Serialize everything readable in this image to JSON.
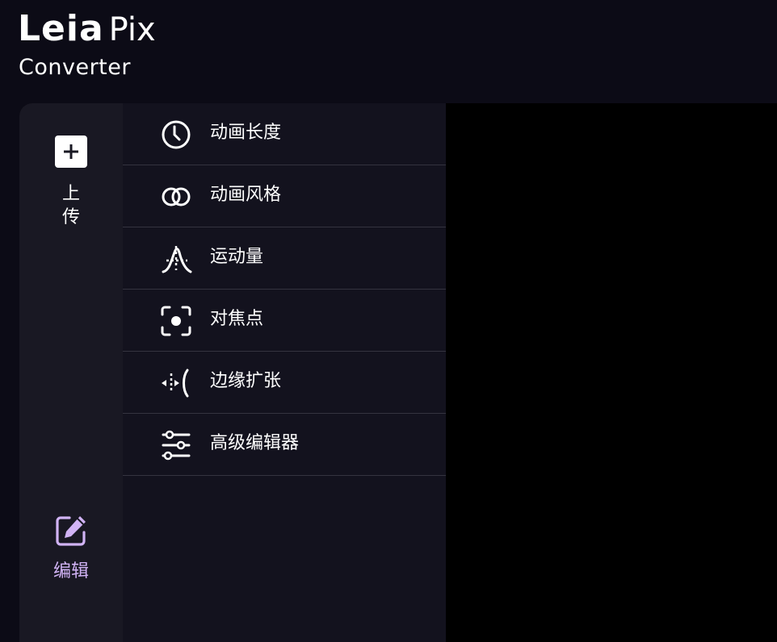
{
  "app": {
    "logo_brand": "Leia",
    "logo_product": "Pix",
    "logo_subtitle": "Converter"
  },
  "rail": {
    "upload_label": "上传",
    "upload_icon": "plus-icon",
    "edit_label": "编辑",
    "edit_icon": "edit-icon",
    "edit_color": "#d1b3f5"
  },
  "menu": {
    "items": [
      {
        "label": "动画长度",
        "icon": "clock-icon"
      },
      {
        "label": "动画风格",
        "icon": "overlapping-circles-icon"
      },
      {
        "label": "运动量",
        "icon": "motion-amount-icon"
      },
      {
        "label": "对焦点",
        "icon": "focus-point-icon"
      },
      {
        "label": "边缘扩张",
        "icon": "edge-expand-icon"
      },
      {
        "label": "高级编辑器",
        "icon": "sliders-icon"
      }
    ]
  }
}
